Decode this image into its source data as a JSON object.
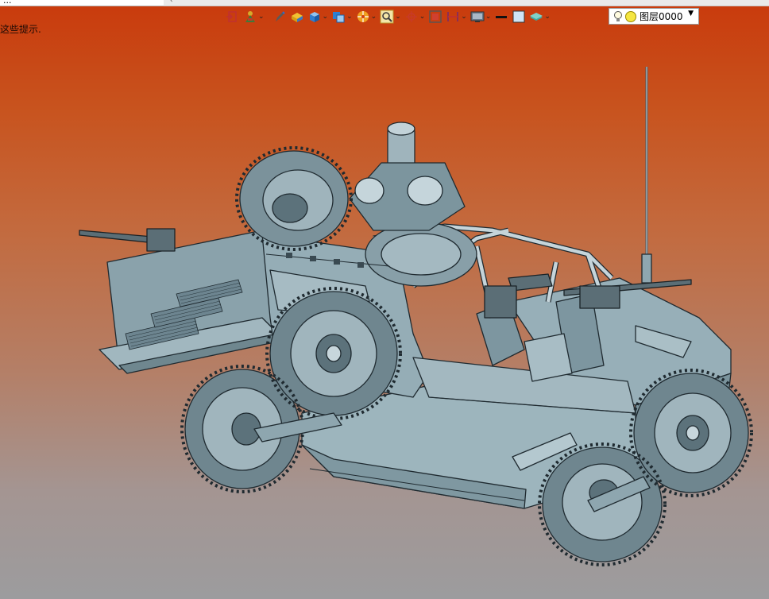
{
  "window": {
    "doc_tab_title": "...",
    "hint_text": "这些提示."
  },
  "toolbar": {
    "buttons": [
      {
        "name": "exit-sketch-icon",
        "has_dropdown": false
      },
      {
        "name": "constraint-icon",
        "has_dropdown": true
      },
      {
        "name": "pen-icon",
        "has_dropdown": false
      },
      {
        "name": "block-icon",
        "has_dropdown": false
      },
      {
        "name": "cube-icon",
        "has_dropdown": true
      },
      {
        "name": "view-orient-icon",
        "has_dropdown": true
      },
      {
        "name": "render-icon",
        "has_dropdown": true
      },
      {
        "name": "zoom-icon",
        "has_dropdown": true
      },
      {
        "name": "crosshair-icon",
        "has_dropdown": true
      },
      {
        "name": "fit-icon",
        "has_dropdown": false
      },
      {
        "name": "section-icon",
        "has_dropdown": true
      },
      {
        "name": "display-icon",
        "has_dropdown": true
      },
      {
        "name": "line-color-icon",
        "has_dropdown": false
      },
      {
        "name": "fill-color-icon",
        "has_dropdown": false
      },
      {
        "name": "layer-icon",
        "has_dropdown": true
      }
    ],
    "layer": {
      "name": "图层0000"
    }
  },
  "colors": {
    "accent_bg_top": "#c93a0c",
    "accent_bg_bottom": "#9c9c9e",
    "model_fill": "#8fa7b0",
    "model_line": "#1f2a30"
  }
}
